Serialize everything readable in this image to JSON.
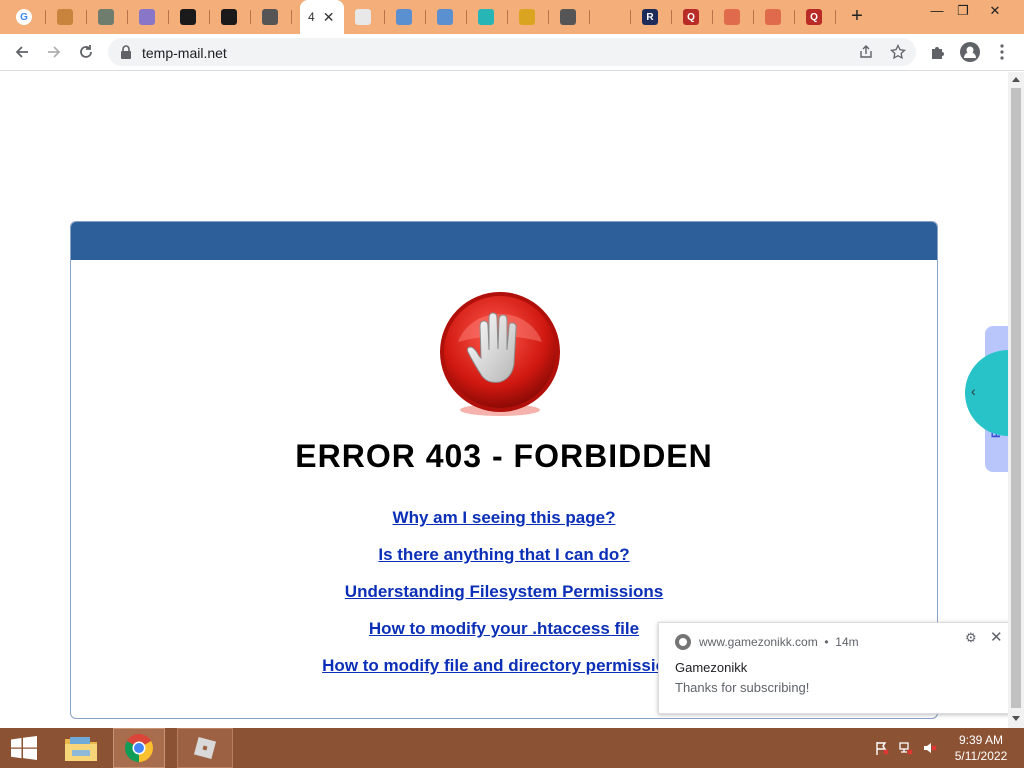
{
  "browser": {
    "active_tab_title": "4",
    "close_tab_glyph": "✕",
    "new_tab_glyph": "+",
    "address": "temp-mail.net",
    "window_controls": [
      "—",
      "❐",
      "✕"
    ]
  },
  "tabs": [
    {
      "icon": "google-icon",
      "color": "#ffffff",
      "letter": "G"
    },
    {
      "icon": "cookie-icon",
      "color": "#c8843c",
      "letter": ""
    },
    {
      "icon": "tools-icon",
      "color": "#6e7d6e",
      "letter": ""
    },
    {
      "icon": "app-icon",
      "color": "#8a76c8",
      "letter": ""
    },
    {
      "icon": "green-cog-icon",
      "color": "#1a1a1a",
      "letter": ""
    },
    {
      "icon": "green-cog-icon",
      "color": "#1a1a1a",
      "letter": ""
    },
    {
      "icon": "roblox-icon",
      "color": "#555555",
      "letter": ""
    },
    {
      "icon": "rainbow-icon",
      "color": "#e8e8e8",
      "letter": ""
    },
    {
      "icon": "hexagon-icon",
      "color": "#5a8fd0",
      "letter": ""
    },
    {
      "icon": "hexagon-icon",
      "color": "#5a8fd0",
      "letter": ""
    },
    {
      "icon": "teal-face-icon",
      "color": "#28b5b5",
      "letter": ""
    },
    {
      "icon": "badge-icon",
      "color": "#d9a520",
      "letter": ""
    },
    {
      "icon": "chrome-gray-icon",
      "color": "#555555",
      "letter": ""
    },
    {
      "icon": "blank-icon",
      "color": "#f3ae7a",
      "letter": ""
    },
    {
      "icon": "r-logo-icon",
      "color": "#1c2b5a",
      "letter": "R"
    },
    {
      "icon": "quora-icon",
      "color": "#b92b27",
      "letter": "Q"
    },
    {
      "icon": "dice-icon",
      "color": "#e06b4c",
      "letter": ""
    },
    {
      "icon": "dice-icon",
      "color": "#e06b4c",
      "letter": ""
    },
    {
      "icon": "quora-icon",
      "color": "#b92b27",
      "letter": "Q"
    }
  ],
  "page": {
    "error_title": "ERROR 403 - FORBIDDEN",
    "links": [
      "Why am I seeing this page?",
      "Is there anything that I can do?",
      "Understanding Filesystem Permissions",
      "How to modify your .htaccess file",
      "How to modify file and directory permissions"
    ],
    "side_widget_text": "FRE",
    "side_chevron": "‹",
    "header_color": "#2d5f9a",
    "link_color": "#0b2fb7"
  },
  "notification": {
    "origin": "www.gamezonikk.com",
    "age": "14m",
    "title": "Gamezonikk",
    "body": "Thanks for subscribing!",
    "gear_glyph": "⚙",
    "close_glyph": "✕"
  },
  "taskbar": {
    "time": "9:39 AM",
    "date": "5/11/2022"
  }
}
